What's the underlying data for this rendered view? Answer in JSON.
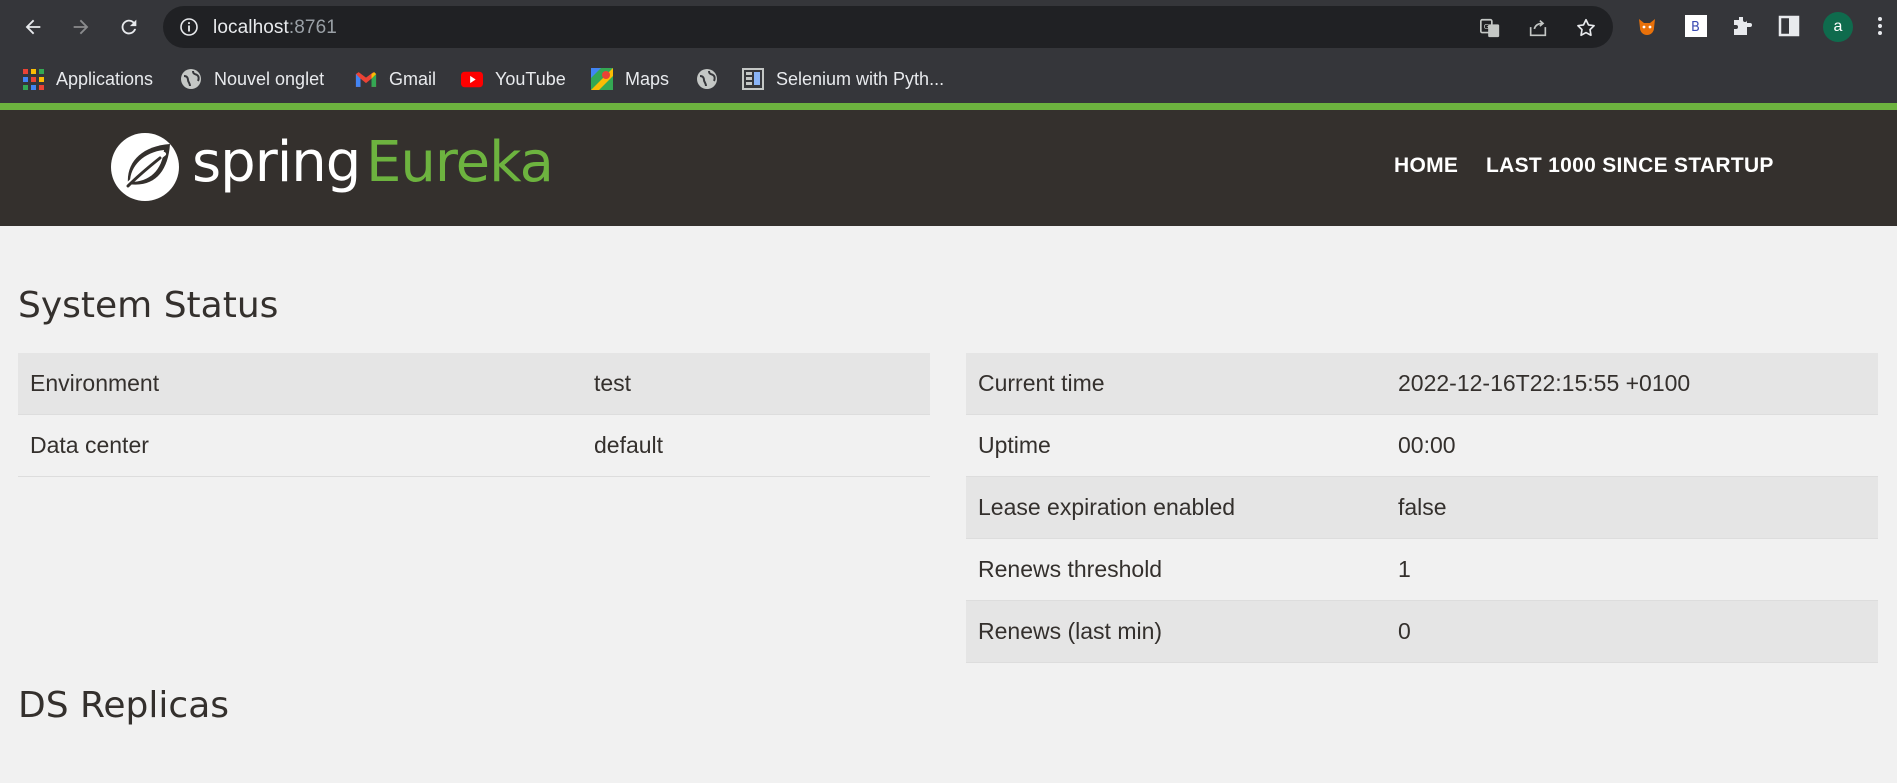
{
  "browser": {
    "url_host": "localhost",
    "url_port": ":8761",
    "avatar_letter": "a",
    "bookmarks": [
      {
        "label": "Applications",
        "icon": "apps-grid-icon"
      },
      {
        "label": "Nouvel onglet",
        "icon": "globe-icon"
      },
      {
        "label": "Gmail",
        "icon": "gmail-icon"
      },
      {
        "label": "YouTube",
        "icon": "youtube-icon"
      },
      {
        "label": "Maps",
        "icon": "maps-icon"
      },
      {
        "label": "",
        "icon": "globe-icon"
      },
      {
        "label": "Selenium with Pyth...",
        "icon": "selenium-icon"
      }
    ]
  },
  "header": {
    "brand_spring": "spring",
    "brand_eureka": "Eureka",
    "nav": [
      "HOME",
      "LAST 1000 SINCE STARTUP"
    ],
    "accent": "#6db33f",
    "bg": "#34302d"
  },
  "system_status": {
    "title": "System Status",
    "left_rows": [
      {
        "label": "Environment",
        "value": "test"
      },
      {
        "label": "Data center",
        "value": "default"
      }
    ],
    "right_rows": [
      {
        "label": "Current time",
        "value": "2022-12-16T22:15:55 +0100"
      },
      {
        "label": "Uptime",
        "value": "00:00"
      },
      {
        "label": "Lease expiration enabled",
        "value": "false"
      },
      {
        "label": "Renews threshold",
        "value": "1"
      },
      {
        "label": "Renews (last min)",
        "value": "0"
      }
    ]
  },
  "ds_replicas": {
    "title": "DS Replicas"
  }
}
